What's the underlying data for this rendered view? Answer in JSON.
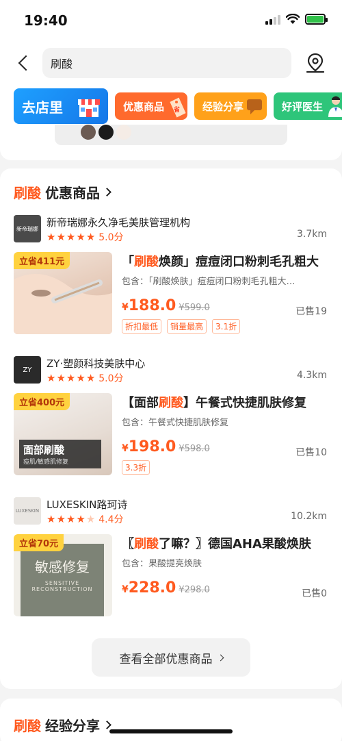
{
  "status_bar": {
    "time": "19:40"
  },
  "search": {
    "query": "刷酸"
  },
  "categories": [
    {
      "label": "去店里"
    },
    {
      "label": "优惠商品"
    },
    {
      "label": "经验分享"
    },
    {
      "label": "好评医生"
    }
  ],
  "deals_section": {
    "keyword": "刷酸",
    "title": "优惠商品",
    "view_all": "查看全部优惠商品",
    "shops": [
      {
        "name": "新帝瑞娜永久净毛美肤管理机构",
        "logo_text": "新帝瑞娜",
        "rating": "5.0分",
        "distance": "3.7km",
        "product": {
          "save_badge": "立省411元",
          "title_prefix": "「",
          "title_keyword": "刷酸",
          "title_suffix": "焕颜」痘痘闭口粉刺毛孔粗大",
          "includes": "包含：「刷酸焕肤」痘痘闭口粉刺毛孔粗大…",
          "price": "188.0",
          "original_price": "¥599.0",
          "sold": "已售19",
          "tags": [
            "折扣最低",
            "销量最高",
            "3.1折"
          ]
        }
      },
      {
        "name": "ZY·塑颜科技美肤中心",
        "logo_text": "ZY",
        "rating": "5.0分",
        "distance": "4.3km",
        "product": {
          "save_badge": "立省400元",
          "title_prefix": "【面部",
          "title_keyword": "刷酸",
          "title_suffix": "】午餐式快捷肌肤修复",
          "includes": "包含：午餐式快捷肌肤修复",
          "price": "198.0",
          "original_price": "¥598.0",
          "sold": "已售10",
          "tags": [
            "3.3折"
          ],
          "image_text_1": "面部刷酸",
          "image_text_2": "痘肌/敏感肌修复"
        }
      },
      {
        "name": "LUXESKIN路珂诗",
        "logo_text": "LUXESKIN",
        "rating": "4.4分",
        "distance": "10.2km",
        "product": {
          "save_badge": "立省70元",
          "title_prefix": "〖",
          "title_keyword": "刷酸",
          "title_suffix": "了嘛？〗德国AHA果酸焕肤",
          "includes": "包含：果酸提亮焕肤",
          "price": "228.0",
          "original_price": "¥298.0",
          "sold": "已售0",
          "tags": [],
          "image_text_1": "敏感修复",
          "image_text_2": "SENSITIVE",
          "image_text_3": "RECONSTRUCTION"
        }
      }
    ]
  },
  "experience_section": {
    "keyword": "刷酸",
    "title": "经验分享"
  },
  "colors": {
    "accent": "#ff5a1f",
    "store_blue": "#1577e8",
    "deals_orange": "#ff6a2d",
    "exp_yellow": "#ffa11a",
    "doctor_green": "#2ec57a"
  },
  "icons": [
    "back-chevron-icon",
    "map-pin-icon",
    "store-icon",
    "discount-tag-icon",
    "chat-bubble-icon",
    "doctor-icon",
    "star-icon",
    "chevron-right-icon"
  ]
}
